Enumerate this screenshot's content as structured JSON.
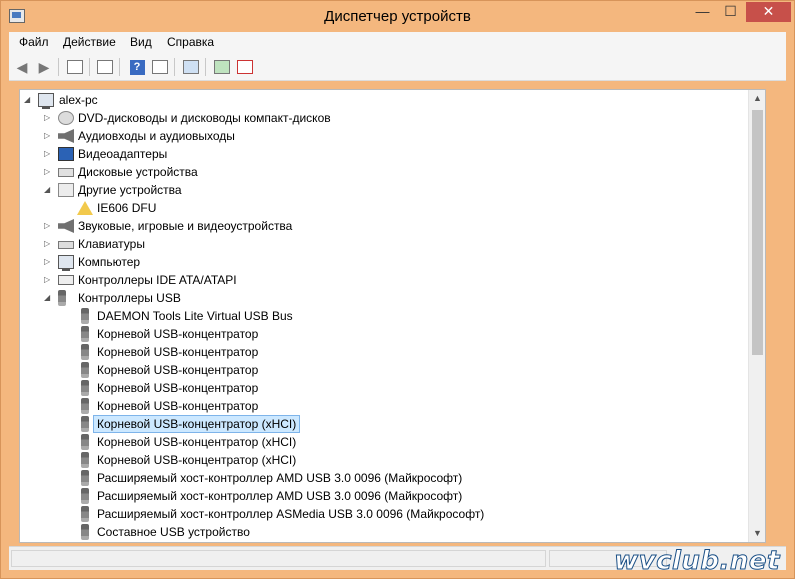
{
  "window": {
    "title": "Диспетчер устройств"
  },
  "window_controls": {
    "minimize": "—",
    "maximize": "☐",
    "close": "✕"
  },
  "menu": {
    "file": "Файл",
    "action": "Действие",
    "view": "Вид",
    "help": "Справка"
  },
  "toolbar": {
    "back": "◀",
    "forward": "▶",
    "help": "?"
  },
  "tree": {
    "root": "alex-pc",
    "rows": [
      {
        "label": "DVD-дисководы и дисководы компакт-дисков",
        "expander": "▷",
        "icon": "disc-icon"
      },
      {
        "label": "Аудиовходы и аудиовыходы",
        "expander": "▷",
        "icon": "speaker-icon"
      },
      {
        "label": "Видеоадаптеры",
        "expander": "▷",
        "icon": "display-adapter-icon"
      },
      {
        "label": "Дисковые устройства",
        "expander": "▷",
        "icon": "disk-drive-icon"
      },
      {
        "label": "Другие устройства",
        "expander": "◢",
        "icon": "other-devices-icon"
      },
      {
        "label": "IE606 DFU",
        "expander": "",
        "icon": "warning-device-icon"
      },
      {
        "label": "Звуковые, игровые и видеоустройства",
        "expander": "▷",
        "icon": "speaker-icon"
      },
      {
        "label": "Клавиатуры",
        "expander": "▷",
        "icon": "keyboard-icon"
      },
      {
        "label": "Компьютер",
        "expander": "▷",
        "icon": "computer-icon"
      },
      {
        "label": "Контроллеры IDE ATA/ATAPI",
        "expander": "▷",
        "icon": "ide-controller-icon"
      },
      {
        "label": "Контроллеры USB",
        "expander": "◢",
        "icon": "usb-icon"
      },
      {
        "label": "DAEMON Tools Lite Virtual USB Bus",
        "expander": "",
        "icon": "usb-icon"
      },
      {
        "label": "Корневой USB-концентратор",
        "expander": "",
        "icon": "usb-icon"
      },
      {
        "label": "Корневой USB-концентратор",
        "expander": "",
        "icon": "usb-icon"
      },
      {
        "label": "Корневой USB-концентратор",
        "expander": "",
        "icon": "usb-icon"
      },
      {
        "label": "Корневой USB-концентратор",
        "expander": "",
        "icon": "usb-icon"
      },
      {
        "label": "Корневой USB-концентратор",
        "expander": "",
        "icon": "usb-icon"
      },
      {
        "label": "Корневой USB-концентратор (xHCI)",
        "expander": "",
        "icon": "usb-icon",
        "selected": true
      },
      {
        "label": "Корневой USB-концентратор (xHCI)",
        "expander": "",
        "icon": "usb-icon"
      },
      {
        "label": "Корневой USB-концентратор (xHCI)",
        "expander": "",
        "icon": "usb-icon"
      },
      {
        "label": "Расширяемый хост-контроллер AMD USB 3.0 0096 (Майкрософт)",
        "expander": "",
        "icon": "usb-icon"
      },
      {
        "label": "Расширяемый хост-контроллер AMD USB 3.0 0096 (Майкрософт)",
        "expander": "",
        "icon": "usb-icon"
      },
      {
        "label": "Расширяемый хост-контроллер ASMedia USB 3.0 0096 (Майкрософт)",
        "expander": "",
        "icon": "usb-icon"
      },
      {
        "label": "Составное USB устройство",
        "expander": "",
        "icon": "usb-icon"
      }
    ]
  },
  "scrollbar": {
    "up": "▲",
    "down": "▼"
  },
  "watermark": "wvclub.net"
}
